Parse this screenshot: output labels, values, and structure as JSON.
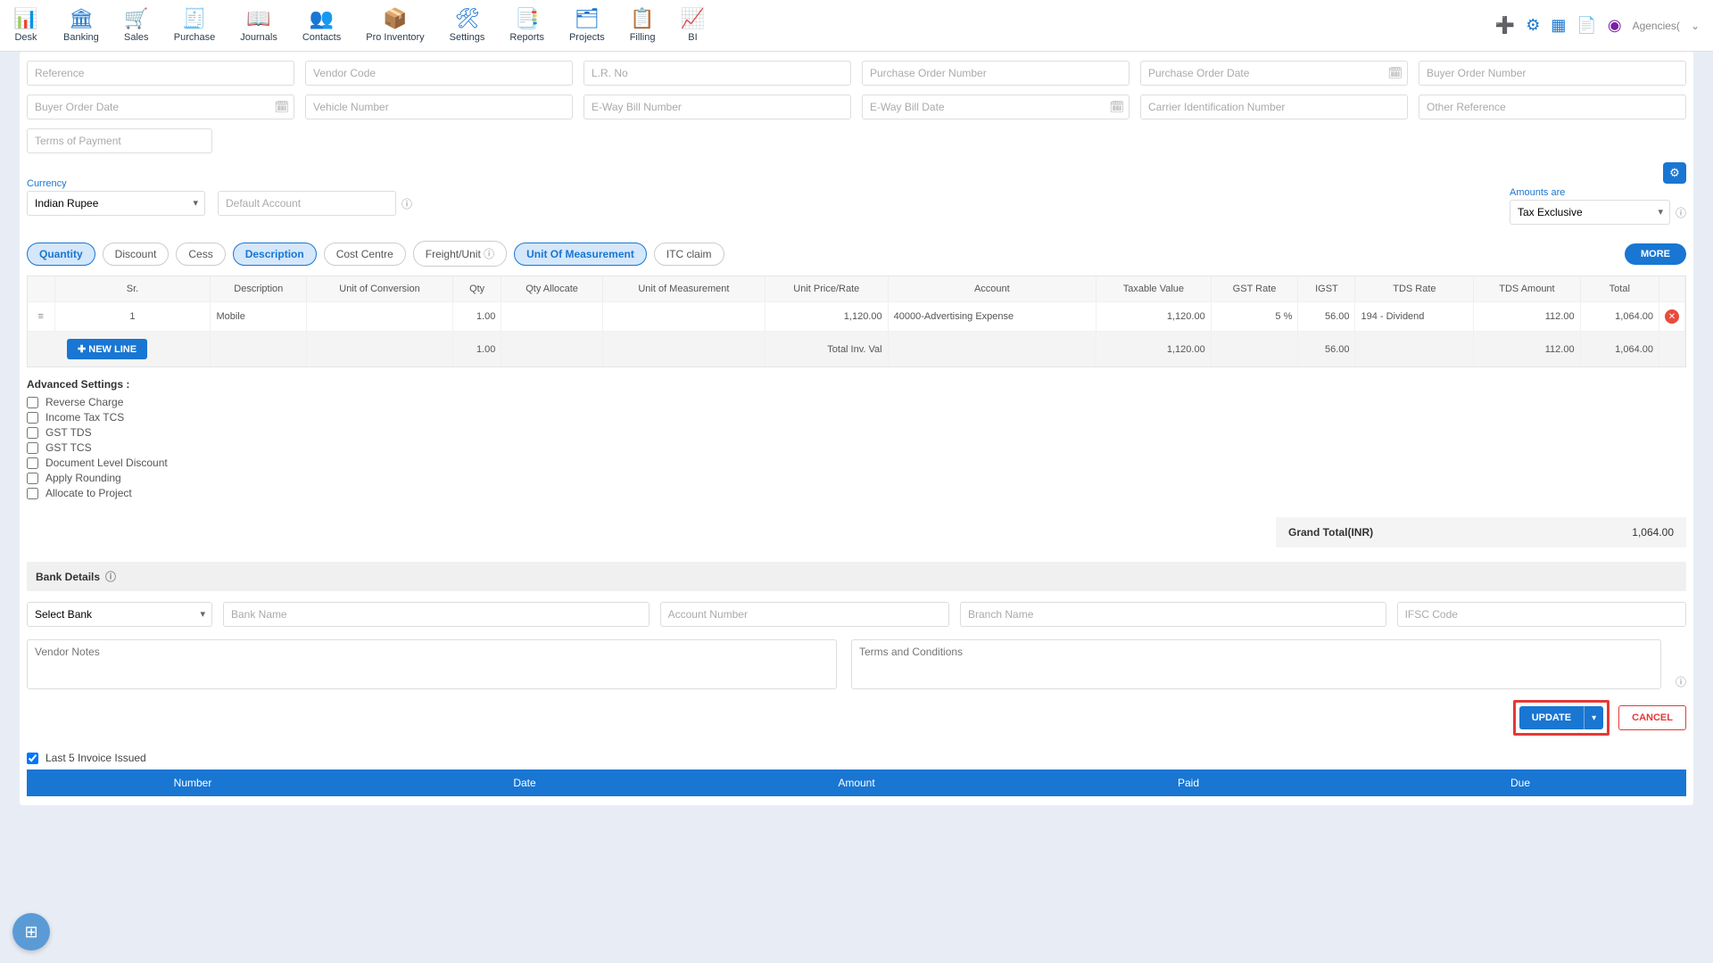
{
  "nav": [
    "Desk",
    "Banking",
    "Sales",
    "Purchase",
    "Journals",
    "Contacts",
    "Pro Inventory",
    "Settings",
    "Reports",
    "Projects",
    "Filling",
    "BI"
  ],
  "topRight": {
    "agencies": "Agencies("
  },
  "fields": {
    "reference": "Reference",
    "vendorCode": "Vendor Code",
    "lrNo": "L.R. No",
    "poNumber": "Purchase Order Number",
    "poDate": "Purchase Order Date",
    "buyerOrderNumber": "Buyer Order Number",
    "buyerOrderDate": "Buyer Order Date",
    "vehicleNumber": "Vehicle Number",
    "ewayBillNumber": "E-Way Bill Number",
    "ewayBillDate": "E-Way Bill Date",
    "carrierId": "Carrier Identification Number",
    "otherRef": "Other Reference",
    "termsPayment": "Terms of Payment"
  },
  "currency": {
    "label": "Currency",
    "value": "Indian Rupee",
    "defaultAccount": "Default Account"
  },
  "amounts": {
    "label": "Amounts are",
    "value": "Tax Exclusive"
  },
  "pills": [
    "Quantity",
    "Discount",
    "Cess",
    "Description",
    "Cost Centre",
    "Freight/Unit",
    "Unit Of Measurement",
    "ITC claim"
  ],
  "moreBtn": "MORE",
  "table": {
    "headers": [
      "Sr.",
      "Description",
      "Unit of Conversion",
      "Qty",
      "Qty Allocate",
      "Unit of Measurement",
      "Unit Price/Rate",
      "Account",
      "Taxable Value",
      "GST Rate",
      "IGST",
      "TDS Rate",
      "TDS Amount",
      "Total"
    ],
    "row": {
      "sr": "1",
      "desc": "Mobile",
      "conv": "",
      "qty": "1.00",
      "qtyAlloc": "",
      "uom": "",
      "rate": "1,120.00",
      "account": "40000-Advertising Expense",
      "taxable": "1,120.00",
      "gstRate": "5 %",
      "igst": "56.00",
      "tdsRate": "194 - Dividend",
      "tdsAmount": "112.00",
      "total": "1,064.00"
    },
    "totals": {
      "qty": "1.00",
      "label": "Total Inv. Val",
      "taxable": "1,120.00",
      "igst": "56.00",
      "tdsAmount": "112.00",
      "total": "1,064.00"
    }
  },
  "newLine": "NEW LINE",
  "adv": {
    "title": "Advanced Settings :",
    "items": [
      "Reverse Charge",
      "Income Tax TCS",
      "GST TDS",
      "GST TCS",
      "Document Level Discount",
      "Apply Rounding",
      "Allocate to Project"
    ]
  },
  "grand": {
    "label": "Grand Total(INR)",
    "value": "1,064.00"
  },
  "bank": {
    "header": "Bank Details",
    "selectBank": "Select Bank",
    "bankName": "Bank Name",
    "accountNumber": "Account Number",
    "branchName": "Branch Name",
    "ifsc": "IFSC Code"
  },
  "notes": {
    "vendor": "Vendor Notes",
    "terms": "Terms and Conditions"
  },
  "actions": {
    "update": "UPDATE",
    "cancel": "CANCEL"
  },
  "last5": {
    "label": "Last 5 Invoice Issued",
    "cols": [
      "Number",
      "Date",
      "Amount",
      "Paid",
      "Due"
    ]
  }
}
